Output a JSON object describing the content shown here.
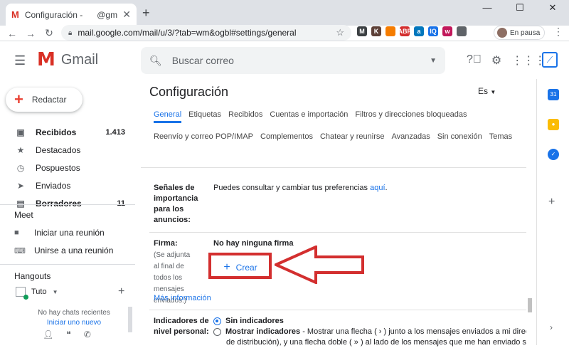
{
  "browser": {
    "tab_title": "Configuración -",
    "tab_title_suffix": "@gm",
    "tab_favicon": "M",
    "url": "mail.google.com/mail/u/3/?tab=wm&ogbl#settings/general",
    "profile_status": "En pausa",
    "extensions": [
      {
        "name": "ext-m-icon",
        "label": "M",
        "color": "#3c4043"
      },
      {
        "name": "ext-k-icon",
        "label": "K",
        "color": "#5d4037"
      },
      {
        "name": "ext-flame-icon",
        "label": "",
        "color": "#f57c00"
      },
      {
        "name": "ext-abp-icon",
        "label": "ABP",
        "color": "#d32f2f"
      },
      {
        "name": "ext-grammarly-icon",
        "label": "a",
        "color": "#0277bd"
      },
      {
        "name": "ext-iq-icon",
        "label": "IQ",
        "color": "#1a73e8"
      },
      {
        "name": "ext-w-icon",
        "label": "w",
        "color": "#c2185b"
      },
      {
        "name": "ext-puzzle-icon",
        "label": "",
        "color": "#5f6368"
      }
    ]
  },
  "gmail": {
    "brand": "Gmail",
    "search_placeholder": "Buscar correo",
    "compose_label": "Redactar"
  },
  "sidebar": {
    "items": [
      {
        "label": "Recibidos",
        "count": "1.413",
        "icon": "inbox-icon",
        "glyph": "▣",
        "bold": true
      },
      {
        "label": "Destacados",
        "count": "",
        "icon": "star-icon",
        "glyph": "★",
        "bold": false
      },
      {
        "label": "Pospuestos",
        "count": "",
        "icon": "clock-icon",
        "glyph": "◷",
        "bold": false
      },
      {
        "label": "Enviados",
        "count": "",
        "icon": "send-icon",
        "glyph": "➤",
        "bold": false
      },
      {
        "label": "Borradores",
        "count": "11",
        "icon": "draft-icon",
        "glyph": "▤",
        "bold": true
      }
    ],
    "meet_title": "Meet",
    "meet_items": [
      {
        "label": "Iniciar una reunión",
        "icon": "video-icon"
      },
      {
        "label": "Unirse a una reunión",
        "icon": "keyboard-icon"
      }
    ],
    "hangouts_title": "Hangouts",
    "hangouts_user": "Tuto",
    "no_chats": "No hay chats recientes",
    "start_new": "Iniciar uno nuevo"
  },
  "settings": {
    "title": "Configuración",
    "language": "Es",
    "tabs": [
      "General",
      "Etiquetas",
      "Recibidos",
      "Cuentas e importación",
      "Filtros y direcciones bloqueadas",
      "Reenvío y correo POP/IMAP",
      "Complementos",
      "Chatear y reunirse",
      "Avanzadas",
      "Sin conexión",
      "Temas"
    ],
    "importance_label": "Señales de importancia para los anuncios:",
    "importance_text": "Puedes consultar y cambiar tus preferencias",
    "importance_link": "aquí",
    "signature_label": "Firma:",
    "signature_note": "(Se adjunta al final de todos los mensajes enviados.)",
    "signature_none": "No hay ninguna firma",
    "create_label": "Crear",
    "more_info": "Más información",
    "indicators_label": "Indicadores de nivel personal:",
    "indicator_option1": "Sin indicadores",
    "indicator_option2": "Mostrar indicadores",
    "indicator_option2_desc": "- Mostrar una flecha ( › ) junto a los mensajes enviados a mi direc",
    "indicator_option2_desc2": "de distribución), y una flecha doble ( » ) al lado de los mensajes que me han enviado so"
  }
}
